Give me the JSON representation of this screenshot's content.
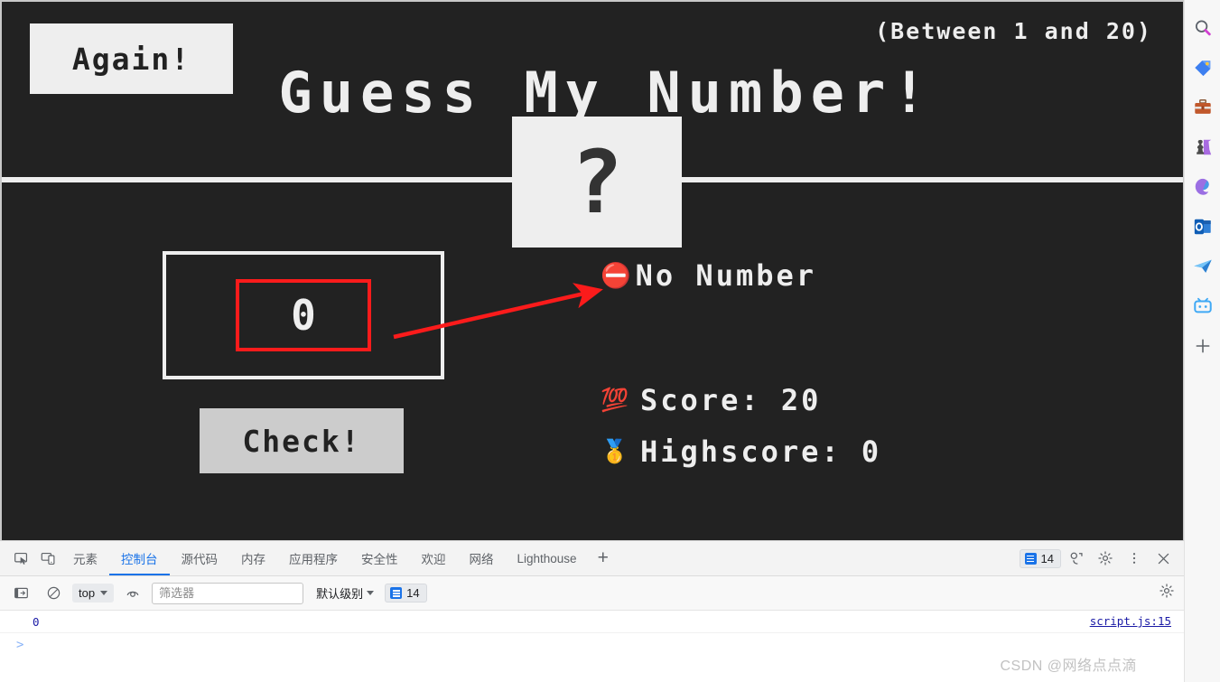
{
  "game": {
    "again_button": "Again!",
    "range_hint": "(Between 1 and 20)",
    "title": "Guess My Number!",
    "secret_display": "?",
    "guess_value": "0",
    "check_button": "Check!",
    "message": "No Number",
    "message_icon": "⛔",
    "score_icon": "💯",
    "score_label": "Score: 20",
    "highscore_icon": "🥇",
    "highscore_label": "Highscore: 0",
    "colors": {
      "background": "#222222",
      "foreground": "#eeeeee",
      "button": "#cccccc",
      "annotation": "#fb1b1b"
    }
  },
  "annotations": {
    "highlight_box_color": "#fb1b1b",
    "arrow_color": "#fb1b1b"
  },
  "sidebar": {
    "icons": [
      {
        "name": "search-icon",
        "glyph": "search"
      },
      {
        "name": "shopping-tag-icon",
        "glyph": "tag"
      },
      {
        "name": "tools-briefcase-icon",
        "glyph": "briefcase"
      },
      {
        "name": "games-icon",
        "glyph": "pawn"
      },
      {
        "name": "office-icon",
        "glyph": "office"
      },
      {
        "name": "outlook-icon",
        "glyph": "outlook"
      },
      {
        "name": "telegram-icon",
        "glyph": "plane"
      },
      {
        "name": "bilibili-icon",
        "glyph": "tv"
      },
      {
        "name": "add-sidebar-app-icon",
        "glyph": "plus"
      }
    ]
  },
  "devtools": {
    "tabs": [
      {
        "label": "元素",
        "active": false
      },
      {
        "label": "控制台",
        "active": true
      },
      {
        "label": "源代码",
        "active": false
      },
      {
        "label": "内存",
        "active": false
      },
      {
        "label": "应用程序",
        "active": false
      },
      {
        "label": "安全性",
        "active": false
      },
      {
        "label": "欢迎",
        "active": false
      },
      {
        "label": "网络",
        "active": false
      },
      {
        "label": "Lighthouse",
        "active": false
      }
    ],
    "add_tab": "+",
    "message_count": "14",
    "console": {
      "context": "top",
      "filter_placeholder": "筛选器",
      "filter_value": "",
      "level": "默认级别",
      "level_count": "14",
      "rows": [
        {
          "value": "0",
          "source": "script.js:15"
        }
      ],
      "prompt": ">"
    }
  },
  "watermark": "CSDN @网络点点滴"
}
